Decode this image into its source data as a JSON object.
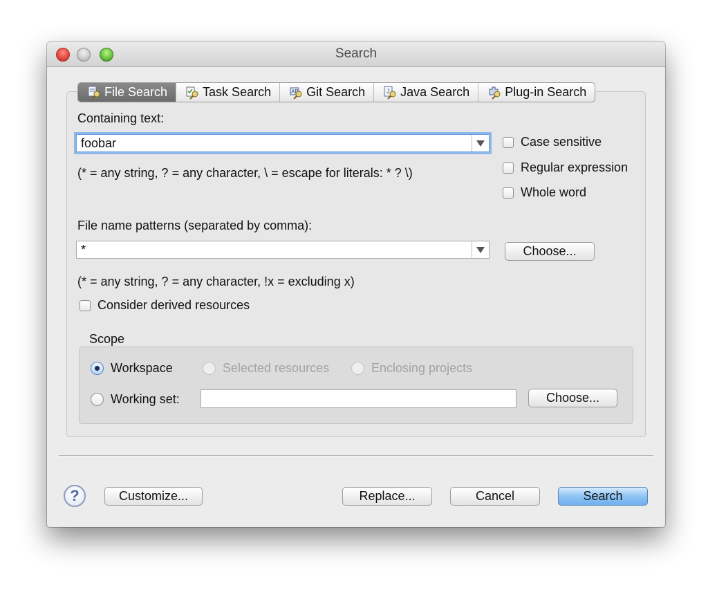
{
  "window": {
    "title": "Search"
  },
  "tabs": [
    {
      "label": "File Search",
      "icon": "file-search-icon",
      "active": true
    },
    {
      "label": "Task Search",
      "icon": "task-search-icon",
      "active": false
    },
    {
      "label": "Git Search",
      "icon": "git-search-icon",
      "active": false
    },
    {
      "label": "Java Search",
      "icon": "java-search-icon",
      "active": false
    },
    {
      "label": "Plug-in Search",
      "icon": "plugin-search-icon",
      "active": false
    }
  ],
  "containing_text": {
    "label": "Containing text:",
    "value": "foobar",
    "hint": "(* = any string, ? = any character, \\ = escape for literals: * ? \\)"
  },
  "options": {
    "case_sensitive": "Case sensitive",
    "regular_expression": "Regular expression",
    "whole_word": "Whole word"
  },
  "file_patterns": {
    "label": "File name patterns (separated by comma):",
    "value": "*",
    "choose_label": "Choose...",
    "hint": "(* = any string, ? = any character, !x = excluding x)"
  },
  "derived": {
    "label": "Consider derived resources"
  },
  "scope": {
    "label": "Scope",
    "workspace": "Workspace",
    "selected_resources": "Selected resources",
    "enclosing_projects": "Enclosing projects",
    "working_set": "Working set:",
    "working_set_value": "",
    "choose_label": "Choose..."
  },
  "buttons": {
    "help": "?",
    "customize": "Customize...",
    "replace": "Replace...",
    "cancel": "Cancel",
    "search": "Search"
  },
  "colors": {
    "accent": "#6eb0ee",
    "focus_ring": "#8fb8ea"
  }
}
